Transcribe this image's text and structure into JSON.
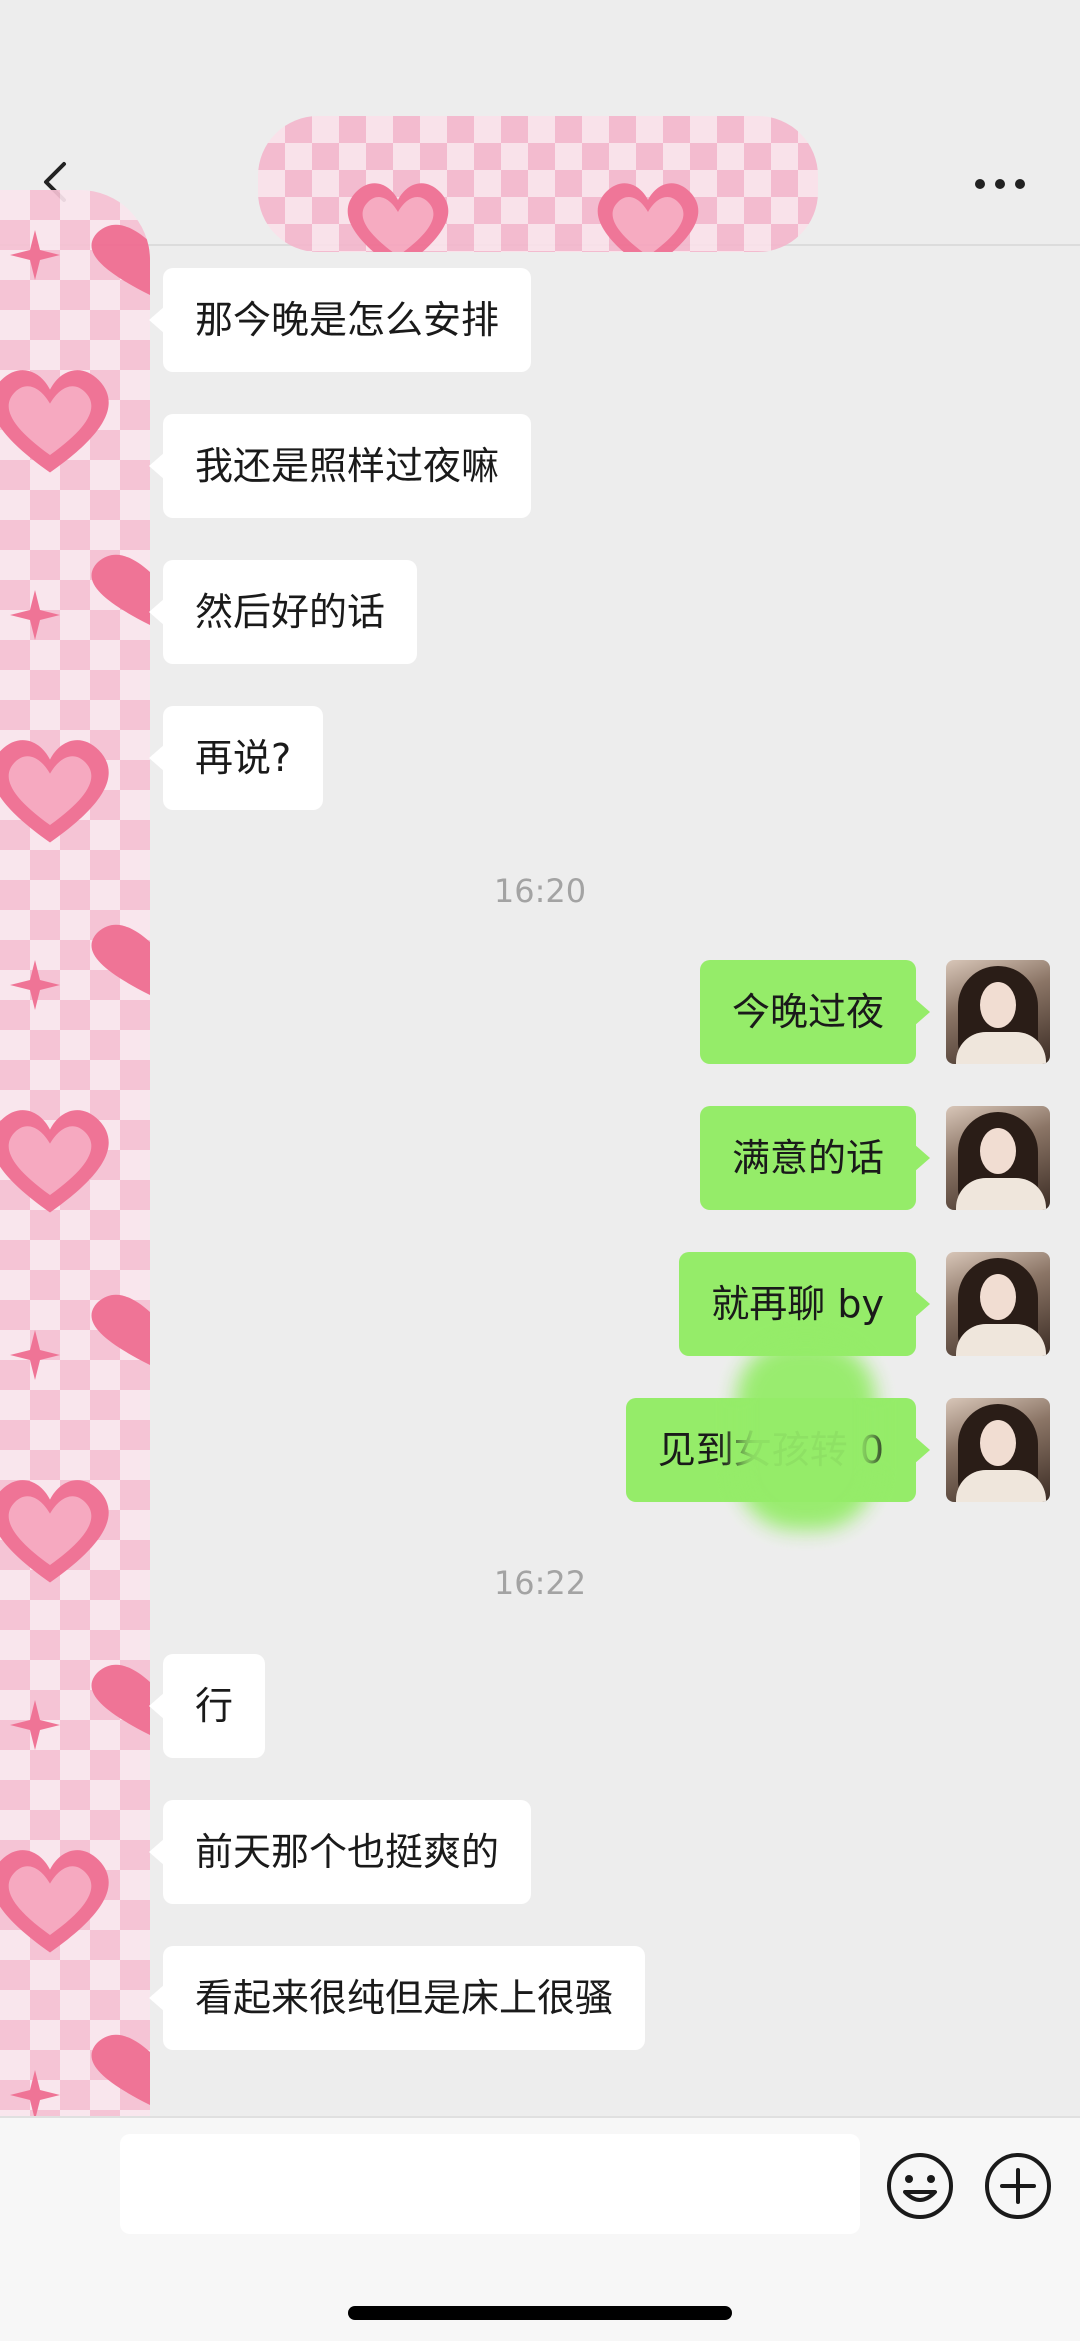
{
  "header": {
    "back_icon": "chevron-left-icon",
    "more_icon": "ellipsis-icon",
    "title_label": "🩷 🩷"
  },
  "messages": [
    {
      "side": "left",
      "text": "那今晚是怎么安排"
    },
    {
      "side": "left",
      "text": "我还是照样过夜嘛"
    },
    {
      "side": "left",
      "text": "然后好的话"
    },
    {
      "side": "left",
      "text": "再说?"
    },
    {
      "type": "time",
      "text": "16:20"
    },
    {
      "side": "right",
      "text": "今晚过夜"
    },
    {
      "side": "right",
      "text": "满意的话"
    },
    {
      "side": "right",
      "text": "就再聊 by"
    },
    {
      "side": "right",
      "text": "见到女孩转      0"
    },
    {
      "type": "time",
      "text": "16:22"
    },
    {
      "side": "left",
      "text": "行"
    },
    {
      "side": "left",
      "text": "前天那个也挺爽的"
    },
    {
      "side": "left",
      "text": "看起来很纯但是床上很骚"
    }
  ],
  "input": {
    "placeholder": "",
    "emoji_icon": "emoji-face-icon",
    "plus_icon": "plus-circle-icon"
  },
  "colors": {
    "background": "#ededed",
    "sent_bubble": "#95ec69",
    "received_bubble": "#ffffff",
    "timestamp": "#a3a3a3",
    "sticker_pink": "#f06a8f"
  }
}
